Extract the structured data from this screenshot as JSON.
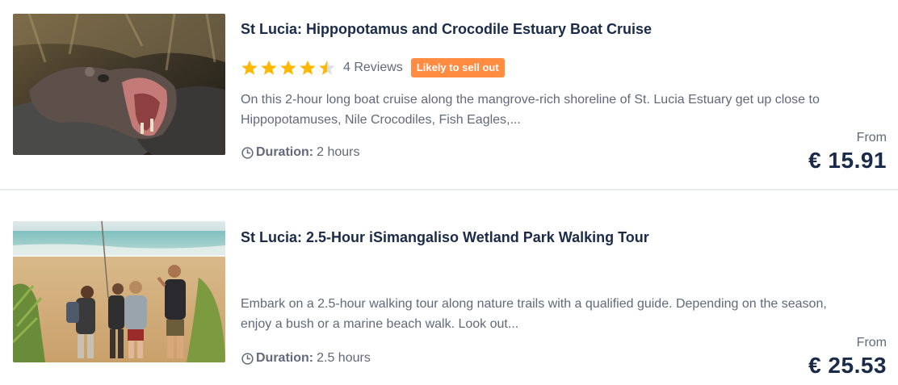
{
  "activities": [
    {
      "title": "St Lucia: Hippopotamus and Crocodile Estuary Boat Cruise",
      "image_alt": "hippopotamus-photo",
      "rating": 4.5,
      "reviews": "4 Reviews",
      "badge": "Likely to sell out",
      "description": "On this 2-hour long boat cruise along the mangrove-rich shoreline of St. Lucia Estuary get up close to Hippopotamuses, Nile Crocodiles, Fish Eagles,...",
      "duration_label": "Duration:",
      "duration_value": "2 hours",
      "from_label": "From",
      "price": "€ 15.91"
    },
    {
      "title": "St Lucia: 2.5-Hour iSimangaliso Wetland Park Walking Tour",
      "image_alt": "beach-walking-group-photo",
      "description": "Embark on a 2.5-hour walking tour along nature trails with a qualified guide. Depending on the season, enjoy a bush or a marine beach walk. Look out...",
      "duration_label": "Duration:",
      "duration_value": "2.5 hours",
      "from_label": "From",
      "price": "€ 25.53"
    }
  ],
  "colors": {
    "title": "#1a2b49",
    "secondary_text": "#63687a",
    "star": "#ffb800",
    "badge_bg": "#ff8c41",
    "divider": "#ebeef1"
  }
}
